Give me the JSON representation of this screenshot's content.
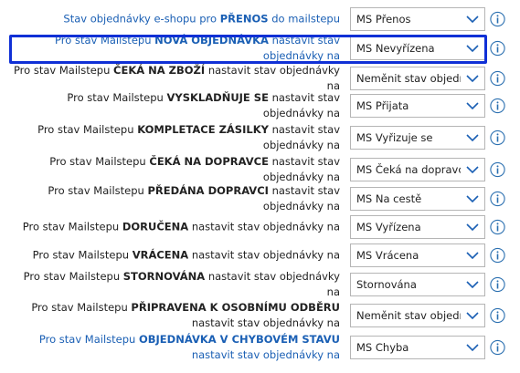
{
  "rows": [
    {
      "pre": "Stav objednávky e-shopu pro ",
      "bold": "PŘENOS",
      "post": " do mailstepu",
      "value": "MS  Přenos",
      "blue": true
    },
    {
      "pre": "Pro stav Mailstepu ",
      "bold": "NOVÁ OBJEDNÁVKA",
      "post": " nastavit stav objednávky na",
      "value": "MS  Nevyřízena",
      "blue": true
    },
    {
      "pre": "Pro stav Mailstepu ",
      "bold": "ČEKÁ NA ZBOŽÍ",
      "post": " nastavit stav objednávky na",
      "value": "Neměnit stav objednávky",
      "blue": false
    },
    {
      "pre": "Pro stav Mailstepu ",
      "bold": "VYSKLADŇUJE SE",
      "post": " nastavit stav objednávky na",
      "value": "MS  Přijata",
      "blue": false
    },
    {
      "pre": "Pro stav Mailstepu ",
      "bold": "KOMPLETACE ZÁSILKY",
      "post": " nastavit stav objednávky na",
      "value": "MS  Vyřizuje se",
      "blue": false
    },
    {
      "pre": "Pro stav Mailstepu ",
      "bold": "ČEKÁ NA DOPRAVCE",
      "post": " nastavit stav objednávky na",
      "value": "MS  Čeká na dopravce",
      "blue": false
    },
    {
      "pre": "Pro stav Mailstepu ",
      "bold": "PŘEDÁNA DOPRAVCI",
      "post": " nastavit stav objednávky na",
      "value": "MS  Na cestě",
      "blue": false
    },
    {
      "pre": "Pro stav Mailstepu ",
      "bold": "DORUČENA",
      "post": " nastavit stav objednávky na",
      "value": "MS  Vyřízena",
      "blue": false
    },
    {
      "pre": "Pro stav Mailstepu ",
      "bold": "VRÁCENA",
      "post": " nastavit stav objednávky na",
      "value": "MS  Vrácena",
      "blue": false
    },
    {
      "pre": "Pro stav Mailstepu ",
      "bold": "STORNOVÁNA",
      "post": " nastavit stav objednávky na",
      "value": "Stornována",
      "blue": false
    },
    {
      "pre": "Pro stav Mailstepu ",
      "bold": "PŘIPRAVENA K OSOBNÍMU ODBĚRU",
      "post": " nastavit stav objednávky na",
      "value": "Neměnit stav objednávky",
      "blue": false
    },
    {
      "pre": "Pro stav Mailstepu ",
      "bold": "OBJEDNÁVKA V CHYBOVÉM STAVU",
      "post": " nastavit stav objednávky na",
      "value": "MS  Chyba",
      "blue": true
    }
  ],
  "colors": {
    "label_blue": "#1a5fb4",
    "chevron": "#1a5fb4",
    "highlight": "#1030d6",
    "info": "#2a6fb0"
  },
  "icons": {
    "dropdown": "chevron-down-icon",
    "info": "info-icon"
  }
}
